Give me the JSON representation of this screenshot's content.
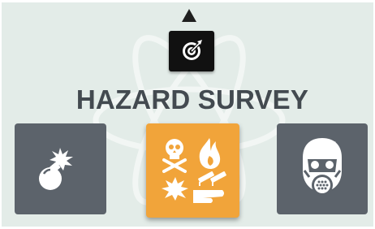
{
  "screen": {
    "title": "HAZARD SURVEY",
    "background_color": "#e3ece8",
    "title_color": "#434a50"
  },
  "nav": {
    "up_arrow_icon": "triangle-up-icon",
    "target_button_icon": "target-arrow-icon"
  },
  "categories": [
    {
      "id": "explosive",
      "icon": "bomb-icon",
      "selected": false,
      "color": "#5c636b"
    },
    {
      "id": "hazmat",
      "icon": "hazardous-materials-icon",
      "selected": true,
      "color": "#f1a43a"
    },
    {
      "id": "respiratory",
      "icon": "gas-mask-icon",
      "selected": false,
      "color": "#5c636b"
    }
  ]
}
